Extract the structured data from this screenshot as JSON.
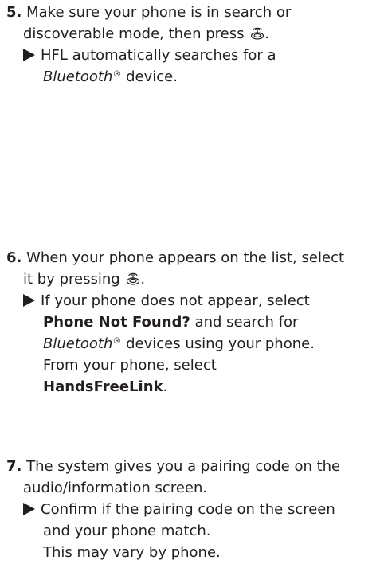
{
  "steps": [
    {
      "number": "5.",
      "line1": "Make sure your phone is in search or",
      "line2": "discoverable mode, then press",
      "line2_end": ".",
      "dial_icon": "selector-knob-icon",
      "result_line1": "HFL automatically searches for a",
      "result_italic": "Bluetooth",
      "result_reg": "®",
      "result_tail": " device."
    },
    {
      "number": "6.",
      "line1": "When your phone appears on the list, select",
      "line2": "it by pressing",
      "line2_end": ".",
      "dial_icon": "selector-knob-icon",
      "note_line1": "If your phone does not appear, select",
      "note_bold1": "Phone Not Found?",
      "note_after_bold1": " and search for",
      "note_italic": "Bluetooth",
      "note_reg": "®",
      "note_after_italic": " devices using your phone.",
      "note_line4": "From your phone, select",
      "note_bold2": "HandsFreeLink",
      "note_end": "."
    },
    {
      "number": "7.",
      "line1": "The system gives you a pairing code on the",
      "line2": "audio/information screen.",
      "note_line1": "Confirm if the pairing code on the screen",
      "note_line2": "and your phone match.",
      "note_line3": "This may vary by phone."
    }
  ],
  "colors": {
    "text": "#231f20",
    "background": "#ffffff"
  }
}
